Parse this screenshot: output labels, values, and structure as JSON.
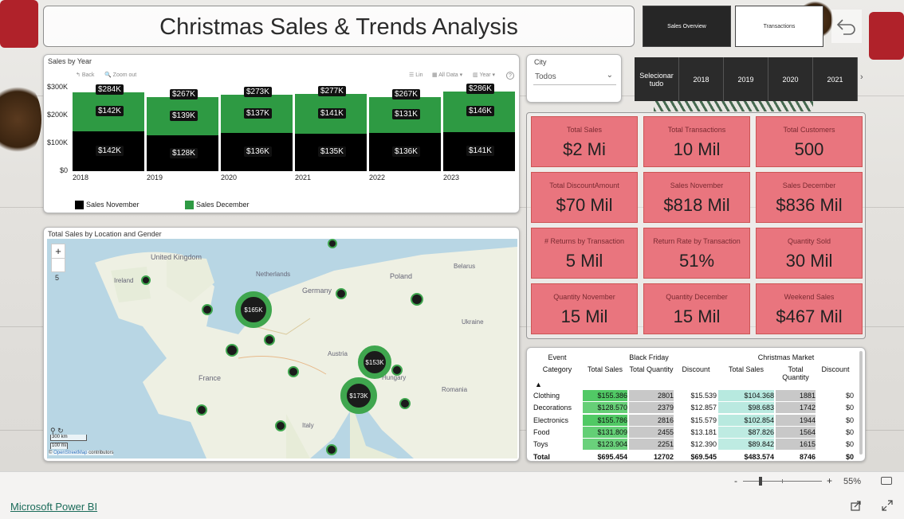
{
  "header": {
    "title": "Christmas Sales & Trends Analysis",
    "nav_sales_overview": "Sales Overview",
    "nav_transactions": "Transactions"
  },
  "icons": {
    "back": "back-arrow-icon",
    "zoom_in": "plus-icon",
    "share": "share-icon",
    "fullscreen": "fullscreen-icon",
    "fit": "fit-page-icon"
  },
  "sales_by_year": {
    "title": "Sales by Year",
    "toolbar": {
      "back": "Back",
      "zoom": "Zoom out",
      "lin": "Lin",
      "all_data": "All Data",
      "year": "Year",
      "help": "?"
    },
    "y_ticks": [
      "$300K",
      "$200K",
      "$100K",
      "$0"
    ]
  },
  "chart_data": {
    "type": "bar",
    "stacked": true,
    "categories": [
      "2018",
      "2019",
      "2020",
      "2021",
      "2022",
      "2023"
    ],
    "series": [
      {
        "name": "Sales November",
        "color": "#000000",
        "values": [
          142,
          128,
          136,
          135,
          136,
          141
        ],
        "labels": [
          "$142K",
          "$128K",
          "$136K",
          "$135K",
          "$136K",
          "$141K"
        ]
      },
      {
        "name": "Sales December",
        "color": "#2e9a43",
        "values": [
          142,
          139,
          137,
          141,
          131,
          146
        ],
        "labels": [
          "$142K",
          "$139K",
          "$137K",
          "$141K",
          "$131K",
          "$146K"
        ]
      }
    ],
    "totals": [
      284,
      267,
      273,
      277,
      267,
      286
    ],
    "total_labels": [
      "$284K",
      "$267K",
      "$273K",
      "$277K",
      "$267K",
      "$286K"
    ],
    "unit": "K",
    "ylim": [
      0,
      300
    ],
    "legend_position": "bottom"
  },
  "city_slicer": {
    "label": "City",
    "value": "Todos"
  },
  "year_slicer": {
    "items": [
      "Selecionar tudo",
      "2018",
      "2019",
      "2020",
      "2021"
    ]
  },
  "kpis": [
    {
      "label": "Total Sales",
      "value": "$2 Mi"
    },
    {
      "label": "Total Transactions",
      "value": "10 Mil"
    },
    {
      "label": "Total Customers",
      "value": "500"
    },
    {
      "label": "Total DiscountAmount",
      "value": "$70 Mil"
    },
    {
      "label": "Sales November",
      "value": "$818 Mil"
    },
    {
      "label": "Sales December",
      "value": "$836 Mil"
    },
    {
      "label": "# Returns by Transaction",
      "value": "5 Mil"
    },
    {
      "label": "Return Rate by Transaction",
      "value": "51%"
    },
    {
      "label": "Quantity Sold",
      "value": "30 Mil"
    },
    {
      "label": "Quantity November",
      "value": "15 Mil"
    },
    {
      "label": "Quantity December",
      "value": "15 Mil"
    },
    {
      "label": "Weekend Sales",
      "value": "$467 Mil"
    }
  ],
  "map": {
    "title": "Total Sales by Location and Gender",
    "zoom_in": "+",
    "zoom_level": "5",
    "scale_km": "300 km",
    "scale_mi": "100 mi",
    "attribution_prefix": "©",
    "attribution_link": "OpenStreetMap",
    "attribution_suffix": "contributors",
    "region_labels": [
      "Ireland",
      "United Kingdom",
      "Netherlands",
      "Germany",
      "Poland",
      "France",
      "Austria",
      "Hungary",
      "Romania",
      "Italy",
      "Belarus",
      "Ukraine"
    ],
    "bubbles": [
      {
        "label": "$165K"
      },
      {
        "label": "$153K"
      },
      {
        "label": "$173K"
      }
    ]
  },
  "event_table": {
    "header_event": "Event",
    "header_category": "Category",
    "groups": [
      {
        "name": "Black Friday",
        "cols": [
          "Total Sales",
          "Total Quantity",
          "Discount"
        ]
      },
      {
        "name": "Christmas Market",
        "cols": [
          "Total Sales",
          "Total Quantity",
          "Discount"
        ]
      }
    ],
    "rows": [
      {
        "category": "Clothing",
        "values": [
          "$155.386",
          "2801",
          "$15.539",
          "$104.368",
          "1881",
          "$0"
        ]
      },
      {
        "category": "Decorations",
        "values": [
          "$128.570",
          "2379",
          "$12.857",
          "$98.683",
          "1742",
          "$0"
        ]
      },
      {
        "category": "Electronics",
        "values": [
          "$155.786",
          "2816",
          "$15.579",
          "$102.854",
          "1944",
          "$0"
        ]
      },
      {
        "category": "Food",
        "values": [
          "$131.809",
          "2455",
          "$13.181",
          "$87.826",
          "1564",
          "$0"
        ]
      },
      {
        "category": "Toys",
        "values": [
          "$123.904",
          "2251",
          "$12.390",
          "$89.842",
          "1615",
          "$0"
        ]
      }
    ],
    "total": {
      "category": "Total",
      "values": [
        "$695.454",
        "12702",
        "$69.545",
        "$483.574",
        "8746",
        "$0"
      ]
    }
  },
  "footer": {
    "brand": "Microsoft Power BI",
    "zoom_minus": "-",
    "zoom_plus": "+",
    "zoom_level": "55%",
    "zoom_slider_fraction": 0.2
  }
}
